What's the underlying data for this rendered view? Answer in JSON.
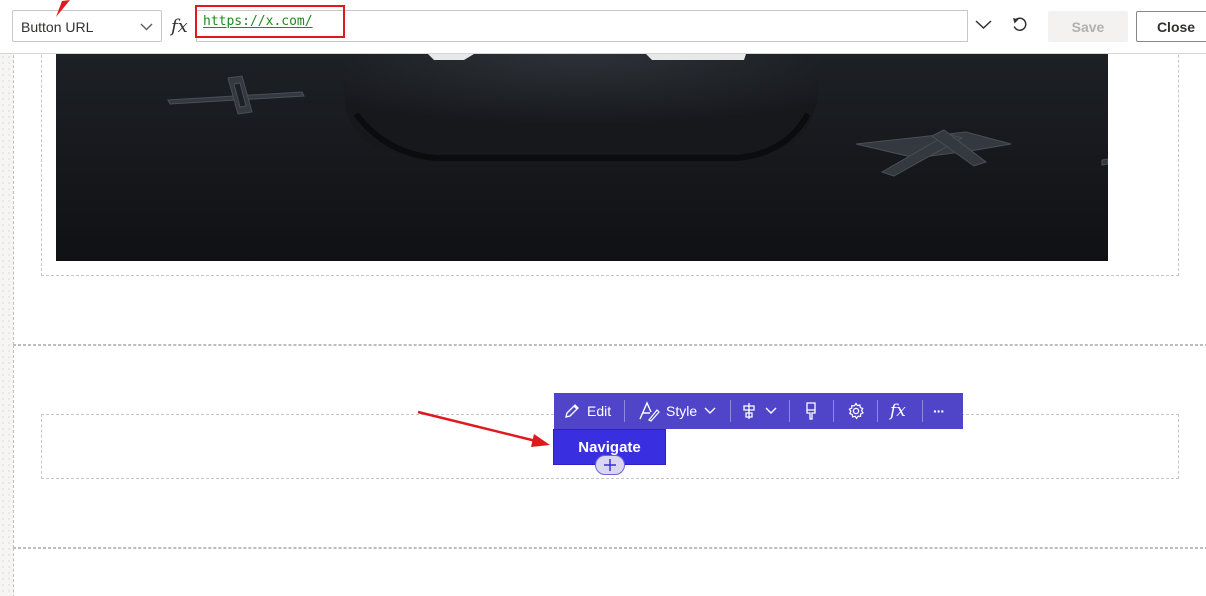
{
  "formula_bar": {
    "property_selected": "Button URL",
    "fx_label": "fx",
    "formula_value_open": "",
    "formula_value_string": "https://x.com/",
    "save_label": "Save",
    "close_label": "Close"
  },
  "canvas": {
    "image_alt": "hero image"
  },
  "toolbar": {
    "edit_label": "Edit",
    "style_label": "Style",
    "fx_label": "fx",
    "more_label": "···"
  },
  "button": {
    "label": "Navigate"
  },
  "colors": {
    "accent": "#5045c9",
    "button": "#3a2fe0",
    "annotation": "#e0191f",
    "formula_string": "#1f8a1f"
  }
}
